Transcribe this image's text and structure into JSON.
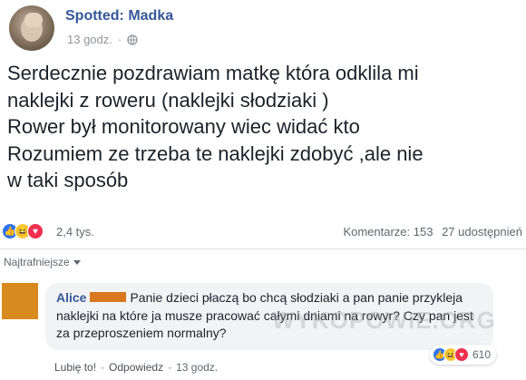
{
  "post": {
    "page_name": "Spotted: Madka",
    "time": "13 godz.",
    "privacy_icon": "globe-icon",
    "text_lines": [
      "Serdecznie pozdrawiam matkę która odklila  mi",
      "naklejki z roweru  (naklejki słodziaki )",
      "Rower był monitorowany wiec widać kto",
      "Rozumiem ze trzeba te naklejki zdobyć ,ale nie",
      "w taki sposób"
    ]
  },
  "stats": {
    "reaction_icons": [
      "like-icon",
      "haha-icon",
      "love-icon"
    ],
    "reaction_count": "2,4 tys.",
    "comments": "Komentarze: 153",
    "shares": "27 udostępnień"
  },
  "comments_section": {
    "sort_label": "Najtrafniejsze",
    "comment": {
      "author": "Alice",
      "text": "Panie dzieci płaczą bo chcą słodziaki a pan panie przykleja naklejki na które ja musze pracować całymi dniami na rowyr? Czy pan jest za przeproszeniem normalny?",
      "reaction_count": "610",
      "like_label": "Lubię to!",
      "reply_label": "Odpowiedz",
      "time": "13 godz."
    },
    "watermark": "WYKOPOWIE.ORG"
  },
  "colors": {
    "link_blue": "#365899",
    "like_blue": "#2f73f0",
    "love_red": "#f0304e",
    "haha_yellow": "#f7c93b",
    "redaction_orange": "#d9781e"
  }
}
